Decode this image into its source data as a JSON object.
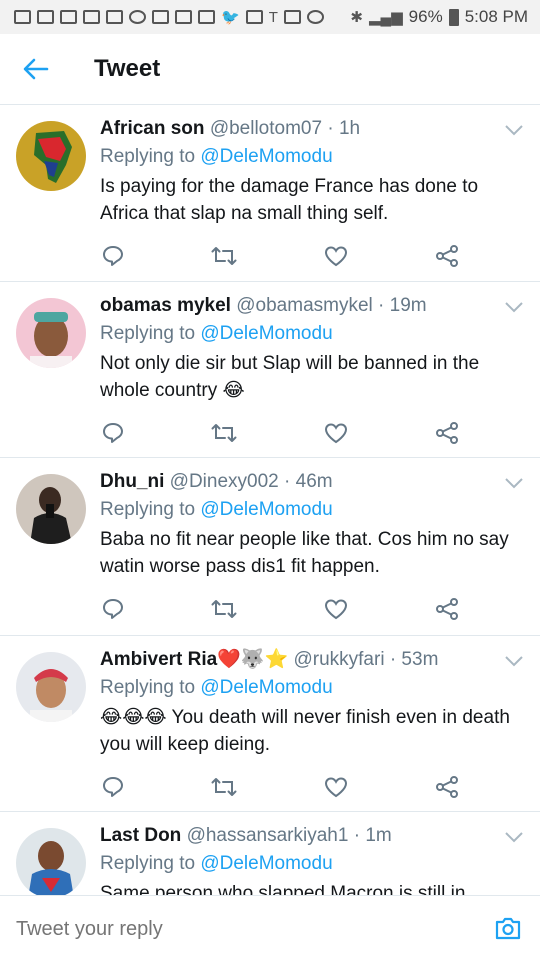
{
  "status_bar": {
    "battery": "96%",
    "time": "5:08 PM"
  },
  "header": {
    "title": "Tweet"
  },
  "tweets": [
    {
      "name": "African son",
      "handle": "@bellotom07",
      "time": "· 1h",
      "replying_label": "Replying to",
      "replying_to": "@DeleMomodu",
      "text": "Is paying for the damage France has done to Africa that slap na small thing self.",
      "emoji_suffix": ""
    },
    {
      "name": "obamas mykel",
      "handle": "@obamasmykel",
      "time": "· 19m",
      "replying_label": "Replying to",
      "replying_to": "@DeleMomodu",
      "text": "Not only die sir but Slap will be banned in the whole country",
      "emoji_suffix": "😂"
    },
    {
      "name": "Dhu_ni",
      "handle": "@Dinexy002",
      "time": "· 46m",
      "replying_label": "Replying to",
      "replying_to": "@DeleMomodu",
      "text": "Baba no fit near people like that. Cos him no say watin worse pass dis1 fit happen.",
      "emoji_suffix": ""
    },
    {
      "name": "Ambivert Ria❤️🐺⭐",
      "handle": "@rukkyfari",
      "time": "· 53m",
      "replying_label": "Replying to",
      "replying_to": "@DeleMomodu",
      "emoji_prefix": "😂😂😂",
      "text": "You death will never finish even in death you will keep dieing.",
      "emoji_suffix": ""
    },
    {
      "name": "Last Don",
      "handle": "@hassansarkiyah1",
      "time": "· 1m",
      "replying_label": "Replying to",
      "replying_to": "@DeleMomodu",
      "text": "Same person who slapped Macron is still in",
      "emoji_suffix": ""
    }
  ],
  "composer": {
    "placeholder": "Tweet your reply"
  },
  "colors": {
    "accent": "#1da1f2",
    "secondary_text": "#657786",
    "icon_gray": "#657786",
    "divider": "#e1e8ed"
  }
}
